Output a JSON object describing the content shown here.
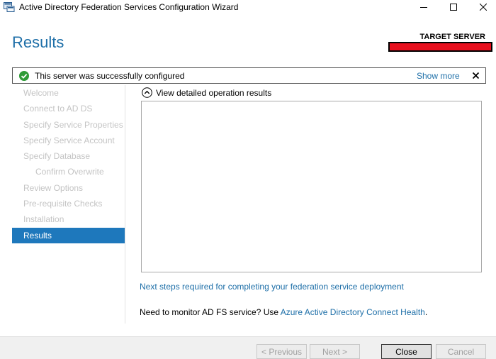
{
  "window": {
    "title": "Active Directory Federation Services Configuration Wizard"
  },
  "header": {
    "page_title": "Results",
    "target_server_label": "TARGET SERVER",
    "target_server_value": ""
  },
  "status": {
    "message": "This server was successfully configured",
    "show_more": "Show more",
    "icon": "success-check-icon",
    "color": "#2e9b36"
  },
  "nav": {
    "items": [
      {
        "label": "Welcome",
        "state": "disabled"
      },
      {
        "label": "Connect to AD DS",
        "state": "disabled"
      },
      {
        "label": "Specify Service Properties",
        "state": "disabled"
      },
      {
        "label": "Specify Service Account",
        "state": "disabled"
      },
      {
        "label": "Specify Database",
        "state": "disabled"
      },
      {
        "label": "Confirm Overwrite",
        "state": "disabled"
      },
      {
        "label": "Review Options",
        "state": "disabled"
      },
      {
        "label": "Pre-requisite Checks",
        "state": "disabled"
      },
      {
        "label": "Installation",
        "state": "disabled"
      },
      {
        "label": "Results",
        "state": "active"
      }
    ]
  },
  "main": {
    "expander_label": "View detailed operation results",
    "results_text": "",
    "next_steps_link": "Next steps required for completing your federation service deployment",
    "monitor_prefix": "Need to monitor AD FS service? Use ",
    "monitor_link": "Azure Active Directory Connect Health",
    "monitor_suffix": "."
  },
  "footer": {
    "previous": "< Previous",
    "next": "Next >",
    "close": "Close",
    "cancel": "Cancel"
  },
  "colors": {
    "accent": "#1e6fa8",
    "nav_active": "#1e78bc",
    "redaction": "#e8101e"
  }
}
